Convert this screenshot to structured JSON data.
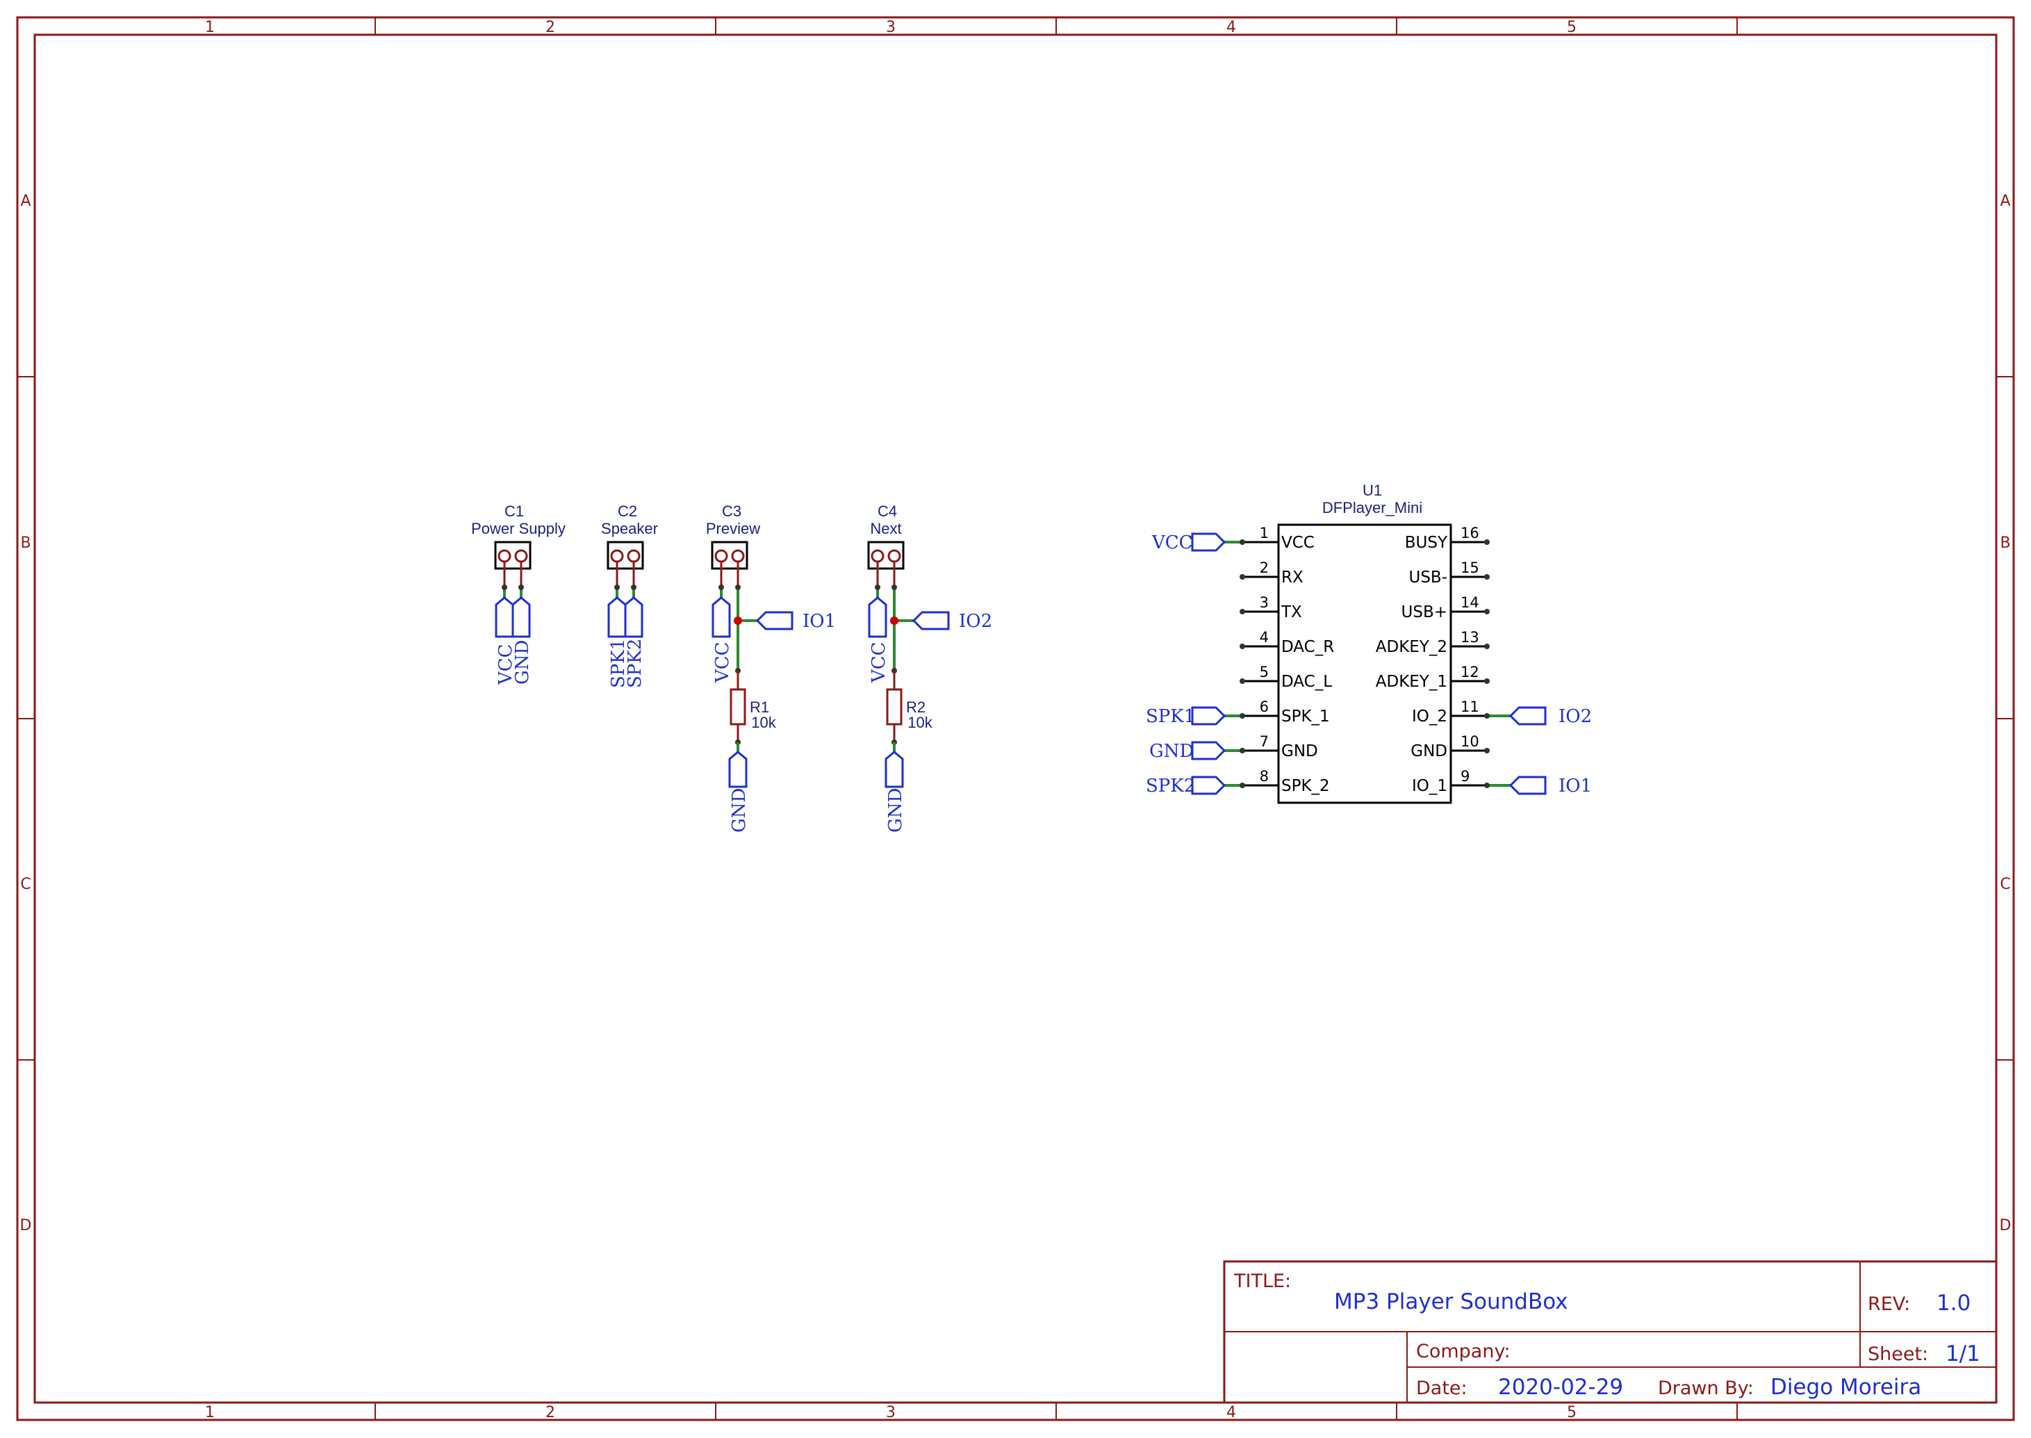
{
  "sheet": {
    "zones_x": [
      "1",
      "2",
      "3",
      "4",
      "5"
    ],
    "zones_y": [
      "A",
      "B",
      "C",
      "D"
    ]
  },
  "connectors": [
    {
      "ref": "C1",
      "label": "Power Supply",
      "nets": [
        "VCC",
        "GND"
      ]
    },
    {
      "ref": "C2",
      "label": "Speaker",
      "nets": [
        "SPK1",
        "SPK2"
      ]
    },
    {
      "ref": "C3",
      "label": "Preview",
      "nets": [
        "VCC"
      ],
      "side_net": "IO1"
    },
    {
      "ref": "C4",
      "label": "Next",
      "nets": [
        "VCC"
      ],
      "side_net": "IO2"
    }
  ],
  "resistors": [
    {
      "ref": "R1",
      "value": "10k",
      "net": "GND"
    },
    {
      "ref": "R2",
      "value": "10k",
      "net": "GND"
    }
  ],
  "module": {
    "ref": "U1",
    "name": "DFPlayer_Mini",
    "left_pins": [
      {
        "num": "1",
        "name": "VCC",
        "net": "VCC"
      },
      {
        "num": "2",
        "name": "RX",
        "net": ""
      },
      {
        "num": "3",
        "name": "TX",
        "net": ""
      },
      {
        "num": "4",
        "name": "DAC_R",
        "net": ""
      },
      {
        "num": "5",
        "name": "DAC_L",
        "net": ""
      },
      {
        "num": "6",
        "name": "SPK_1",
        "net": "SPK1"
      },
      {
        "num": "7",
        "name": "GND",
        "net": "GND"
      },
      {
        "num": "8",
        "name": "SPK_2",
        "net": "SPK2"
      }
    ],
    "right_pins": [
      {
        "num": "16",
        "name": "BUSY",
        "net": ""
      },
      {
        "num": "15",
        "name": "USB-",
        "net": ""
      },
      {
        "num": "14",
        "name": "USB+",
        "net": ""
      },
      {
        "num": "13",
        "name": "ADKEY_2",
        "net": ""
      },
      {
        "num": "12",
        "name": "ADKEY_1",
        "net": ""
      },
      {
        "num": "11",
        "name": "IO_2",
        "net": "IO2"
      },
      {
        "num": "10",
        "name": "GND",
        "net": ""
      },
      {
        "num": "9",
        "name": "IO_1",
        "net": "IO1"
      }
    ]
  },
  "title_block": {
    "title_label": "TITLE:",
    "title": "MP3 Player SoundBox",
    "rev_label": "REV:",
    "rev": "1.0",
    "company_label": "Company:",
    "company": "",
    "sheet_label": "Sheet:",
    "sheet": "1/1",
    "date_label": "Date:",
    "date": "2020-02-29",
    "drawn_label": "Drawn By:",
    "drawn_by": "Diego Moreira"
  },
  "colors": {
    "border": "#8b1a1a",
    "wire": "#2e8b2e",
    "net": "#1f2fd1",
    "junction": "#cc0000"
  }
}
